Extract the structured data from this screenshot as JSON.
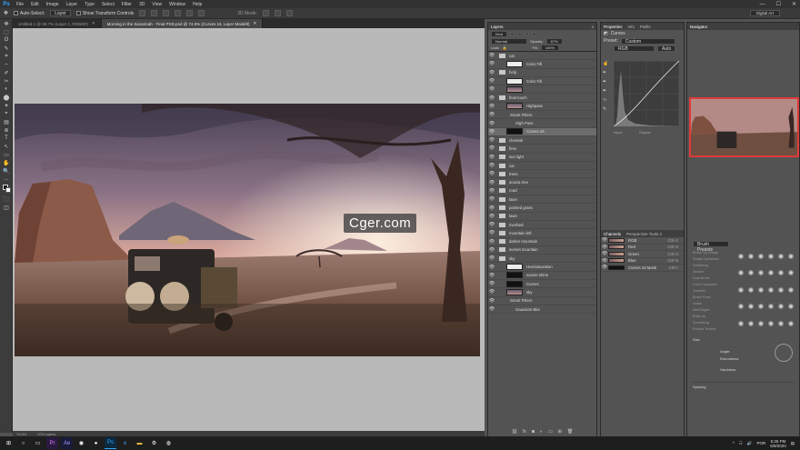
{
  "app": {
    "logo": "Ps"
  },
  "menubar": [
    "File",
    "Edit",
    "Image",
    "Layer",
    "Type",
    "Select",
    "Filter",
    "3D",
    "View",
    "Window",
    "Help"
  ],
  "window_controls": [
    "—",
    "☐",
    "✕"
  ],
  "options": {
    "auto_select": "Auto-Select:",
    "auto_select_value": "Layer",
    "transform": "Show Transform Controls",
    "mode": "3D Mode:",
    "workspace": "Digital Art"
  },
  "tabs": [
    {
      "label": "Untitled-1 @ 66.7% (Layer 1, RGB/8#)",
      "close": "✕"
    },
    {
      "label": "Morning in the Savannah - Final PSD.psd @ 74.6% (Curves 16, Layer Mask/8)",
      "close": "✕"
    }
  ],
  "tools": [
    "✥",
    "⬚",
    "ʘ",
    "✎",
    "⌗",
    "⎯",
    "✐",
    "✂",
    "◐",
    "⬤",
    "✦",
    "⌖",
    "▤",
    "⊕",
    "T",
    "↖",
    "▭",
    "✋",
    "🔍",
    "…",
    "◧",
    "⬛",
    "◫"
  ],
  "statusbar": {
    "zoom": "74.6%",
    "doc": "374 Layers"
  },
  "watermark": "Cger.com",
  "layers": {
    "tabs": [
      "Layers",
      "x"
    ],
    "kind": "Kind",
    "blend": "Normal",
    "opacity_label": "Opacity:",
    "opacity": "67%",
    "lock_label": "Lock:",
    "fill_label": "Fill:",
    "fill": "100%",
    "rows": [
      {
        "name": "cat",
        "type": "folder"
      },
      {
        "name": "Color Fill",
        "type": "fill"
      },
      {
        "name": "help",
        "type": "folder"
      },
      {
        "name": "Color Fill",
        "type": "fill"
      },
      {
        "name": "",
        "type": "img"
      },
      {
        "name": "final touch",
        "type": "folder"
      },
      {
        "name": "Highpass",
        "type": "img"
      },
      {
        "name": "Smart Filters",
        "type": "sub"
      },
      {
        "name": "High Pass",
        "type": "sub2"
      },
      {
        "name": "Curves 16",
        "type": "dark",
        "sel": true
      },
      {
        "name": "cheetah",
        "type": "folder"
      },
      {
        "name": "fires",
        "type": "folder"
      },
      {
        "name": "sun light",
        "type": "folder"
      },
      {
        "name": "car",
        "type": "folder"
      },
      {
        "name": "trees",
        "type": "folder"
      },
      {
        "name": "acacia tree",
        "type": "folder"
      },
      {
        "name": "road",
        "type": "folder"
      },
      {
        "name": "lawn",
        "type": "folder"
      },
      {
        "name": "painted grass",
        "type": "folder"
      },
      {
        "name": "lawn",
        "type": "folder"
      },
      {
        "name": "riverbed",
        "type": "folder"
      },
      {
        "name": "mountain left",
        "type": "folder"
      },
      {
        "name": "darker mountain",
        "type": "folder"
      },
      {
        "name": "sunset mountain",
        "type": "folder"
      },
      {
        "name": "sky",
        "type": "folder"
      },
      {
        "name": "Hue/Saturation",
        "type": "fill"
      },
      {
        "name": "sunset shine",
        "type": "dark"
      },
      {
        "name": "Curves",
        "type": "dark"
      },
      {
        "name": "sky",
        "type": "img"
      },
      {
        "name": "Smart Filters",
        "type": "sub"
      },
      {
        "name": "Gaussian Blur",
        "type": "sub2"
      }
    ]
  },
  "properties": {
    "tabs": [
      "Properties",
      "Info",
      "Paths"
    ],
    "title": "Curves",
    "preset_label": "Preset:",
    "preset": "Custom",
    "channel": "RGB",
    "auto": "Auto",
    "input_label": "Input:",
    "output_label": "Output:"
  },
  "channels": {
    "tabs": [
      "Channels",
      "Perspective Tools 2"
    ],
    "rows": [
      {
        "name": "RGB",
        "key": "Ctrl+2"
      },
      {
        "name": "Red",
        "key": "Ctrl+3"
      },
      {
        "name": "Green",
        "key": "Ctrl+4"
      },
      {
        "name": "Blue",
        "key": "Ctrl+5"
      },
      {
        "name": "Curves 16 Mask",
        "key": "Ctrl+\\"
      }
    ]
  },
  "navigator": {
    "tab": "Navigator"
  },
  "brushes": {
    "tab": "Brush Presets",
    "items": [
      "Brush Tip Shape",
      "Shape Dynamics",
      "Scattering",
      "Texture",
      "Dual Brush",
      "Color Dynamics",
      "Transfer",
      "Brush Pose",
      "Noise",
      "Wet Edges",
      "Build-up",
      "Smoothing",
      "Protect Texture"
    ],
    "size_label": "Size",
    "angle": "Angle:",
    "roundness": "Roundness:",
    "hardness": "Hardness",
    "spacing": "Spacing"
  },
  "taskbar": {
    "time": "5:26 PM",
    "date": "6/8/2020",
    "lang": "POR"
  }
}
